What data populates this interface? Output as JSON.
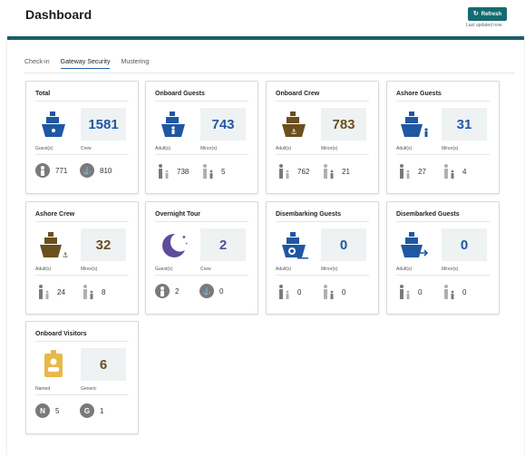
{
  "header": {
    "title": "Dashboard",
    "refresh_label": "Refresh",
    "last_updated": "Last updated now"
  },
  "tabs": [
    {
      "label": "Check-in"
    },
    {
      "label": "Gateway Security"
    },
    {
      "label": "Mustering"
    }
  ],
  "colors": {
    "accent": "#146b70",
    "navy": "#1f57a3",
    "brown": "#6b4f1d",
    "purple": "#5e4b9c",
    "gold": "#e8b94a",
    "gray": "#7a7a7a"
  },
  "cards": [
    {
      "title": "Total",
      "count": "1581",
      "left_caption": "Guest(s)",
      "right_caption": "Crew",
      "left_value": "771",
      "right_value": "810",
      "icon": "ship-icon"
    },
    {
      "title": "Onboard Guests",
      "count": "743",
      "left_caption": "Adult(s)",
      "right_caption": "Minor(s)",
      "left_value": "738",
      "right_value": "5",
      "icon": "ship-guest-icon"
    },
    {
      "title": "Onboard Crew",
      "count": "783",
      "left_caption": "Adult(s)",
      "right_caption": "Minor(s)",
      "left_value": "762",
      "right_value": "21",
      "icon": "ship-crew-icon"
    },
    {
      "title": "Ashore Guests",
      "count": "31",
      "left_caption": "Adult(s)",
      "right_caption": "Minor(s)",
      "left_value": "27",
      "right_value": "4",
      "icon": "ship-ashore-guest-icon"
    },
    {
      "title": "Ashore Crew",
      "count": "32",
      "left_caption": "Adult(s)",
      "right_caption": "Minor(s)",
      "left_value": "24",
      "right_value": "8",
      "icon": "ship-ashore-crew-icon"
    },
    {
      "title": "Overnight Tour",
      "count": "2",
      "left_caption": "Guest(s)",
      "right_caption": "Crew",
      "left_value": "2",
      "right_value": "0",
      "icon": "moon-icon"
    },
    {
      "title": "Disembarking Guests",
      "count": "0",
      "left_caption": "Adult(s)",
      "right_caption": "Minor(s)",
      "left_value": "0",
      "right_value": "0",
      "icon": "ship-disembarking-icon"
    },
    {
      "title": "Disembarked Guests",
      "count": "0",
      "left_caption": "Adult(s)",
      "right_caption": "Minor(s)",
      "left_value": "0",
      "right_value": "0",
      "icon": "ship-disembarked-icon"
    },
    {
      "title": "Onboard Visitors",
      "count": "6",
      "left_caption": "Named",
      "right_caption": "Generic",
      "left_value": "5",
      "right_value": "1",
      "icon": "visitor-badge-icon",
      "left_badge": "N",
      "right_badge": "G"
    }
  ]
}
